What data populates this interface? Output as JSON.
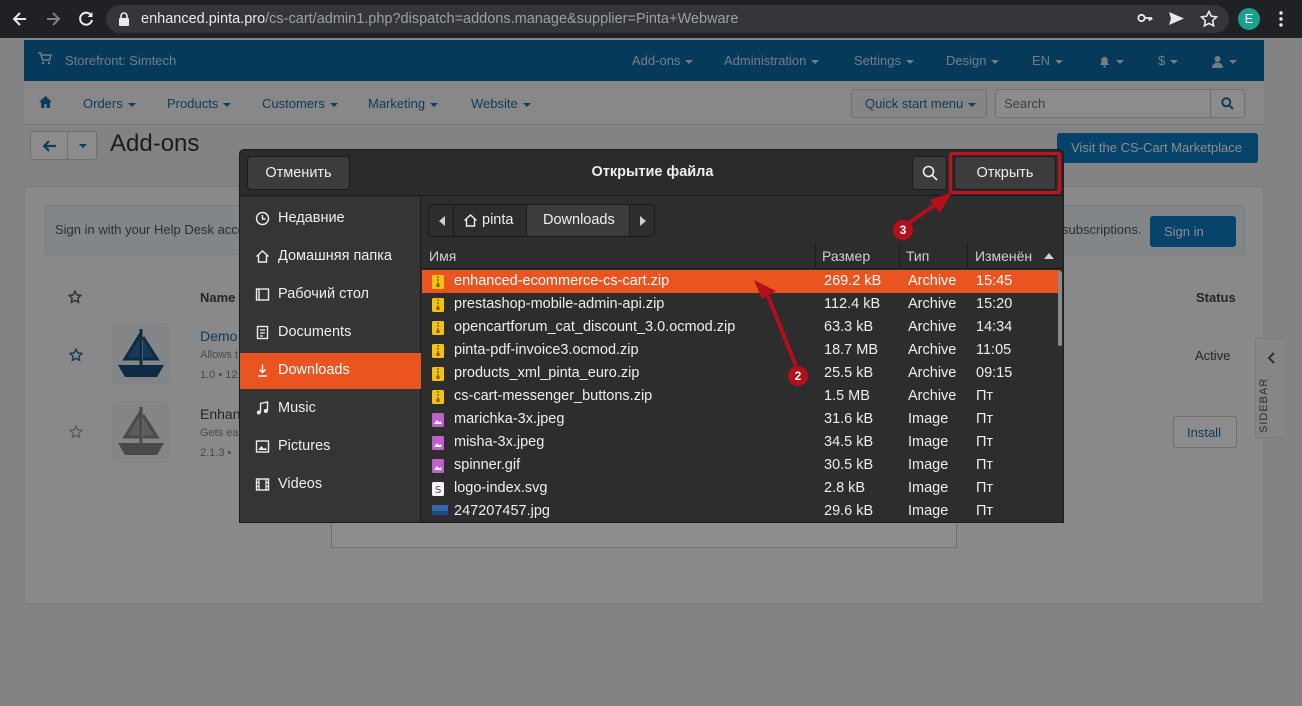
{
  "browser": {
    "url_host": "enhanced.pinta.pro",
    "url_path": "/cs-cart/admin1.php?dispatch=addons.manage&supplier=Pinta+Webware",
    "profile_letter": "E"
  },
  "admin": {
    "storefront": "Storefront: Simtech",
    "top_menu": [
      "Add-ons",
      "Administration",
      "Settings",
      "Design",
      "EN",
      "$"
    ],
    "main_menu": [
      "Orders",
      "Products",
      "Customers",
      "Marketing",
      "Website"
    ],
    "quick_start": "Quick start menu",
    "search_placeholder": "Search",
    "page_title": "Add-ons",
    "marketplace_button": "Visit the CS-Cart Marketplace",
    "helpdesk_text": "Sign in with your Help Desk acco",
    "helpdesk_suffix": "subscriptions.",
    "signin_button": "Sign in",
    "col_name": "Name",
    "col_status": "Status",
    "rows": [
      {
        "title": "Demo",
        "sub1": "Allows t",
        "sub2": "1.0 • 12,",
        "status": "Active"
      },
      {
        "title": "Enhanc",
        "sub1": "Gets eas",
        "sub2": "2.1.3 •",
        "action": "Install"
      }
    ],
    "sidebar_label": "SIDEBAR"
  },
  "dialog": {
    "title": "Открытие файла",
    "cancel": "Отменить",
    "open": "Открыть",
    "places": [
      {
        "label": "Недавние",
        "icon": "clock-icon"
      },
      {
        "label": "Домашняя папка",
        "icon": "home-icon"
      },
      {
        "label": "Рабочий стол",
        "icon": "desktop-icon"
      },
      {
        "label": "Documents",
        "icon": "document-icon"
      },
      {
        "label": "Downloads",
        "icon": "download-icon",
        "active": true
      },
      {
        "label": "Music",
        "icon": "music-icon"
      },
      {
        "label": "Pictures",
        "icon": "picture-icon"
      },
      {
        "label": "Videos",
        "icon": "video-icon"
      }
    ],
    "path": [
      "pinta",
      "Downloads"
    ],
    "columns": {
      "name": "Имя",
      "size": "Размер",
      "type": "Тип",
      "modified": "Изменён"
    },
    "files": [
      {
        "name": "enhanced-ecommerce-cs-cart.zip",
        "size": "269.2 kB",
        "type": "Archive",
        "modified": "15:45",
        "kind": "archive",
        "selected": true
      },
      {
        "name": "prestashop-mobile-admin-api.zip",
        "size": "112.4 kB",
        "type": "Archive",
        "modified": "15:20",
        "kind": "archive"
      },
      {
        "name": "opencartforum_cat_discount_3.0.ocmod.zip",
        "size": "63.3 kB",
        "type": "Archive",
        "modified": "14:34",
        "kind": "archive"
      },
      {
        "name": "pinta-pdf-invoice3.ocmod.zip",
        "size": "18.7 MB",
        "type": "Archive",
        "modified": "11:05",
        "kind": "archive"
      },
      {
        "name": "products_xml_pinta_euro.zip",
        "size": "25.5 kB",
        "type": "Archive",
        "modified": "09:15",
        "kind": "archive"
      },
      {
        "name": "cs-cart-messenger_buttons.zip",
        "size": "1.5 MB",
        "type": "Archive",
        "modified": "Пт",
        "kind": "archive"
      },
      {
        "name": "marichka-3x.jpeg",
        "size": "31.6 kB",
        "type": "Image",
        "modified": "Пт",
        "kind": "image"
      },
      {
        "name": "misha-3x.jpeg",
        "size": "34.5 kB",
        "type": "Image",
        "modified": "Пт",
        "kind": "image"
      },
      {
        "name": "spinner.gif",
        "size": "30.5 kB",
        "type": "Image",
        "modified": "Пт",
        "kind": "image"
      },
      {
        "name": "logo-index.svg",
        "size": "2.8 kB",
        "type": "Image",
        "modified": "Пт",
        "kind": "svg"
      },
      {
        "name": "247207457.jpg",
        "size": "29.6 kB",
        "type": "Image",
        "modified": "Пт",
        "kind": "photo"
      }
    ]
  },
  "annotations": {
    "badge_2": "2",
    "badge_3": "3",
    "color": "#b4101c"
  },
  "colors": {
    "accent": "#e95420",
    "cs_blue": "#0a6aa6"
  }
}
